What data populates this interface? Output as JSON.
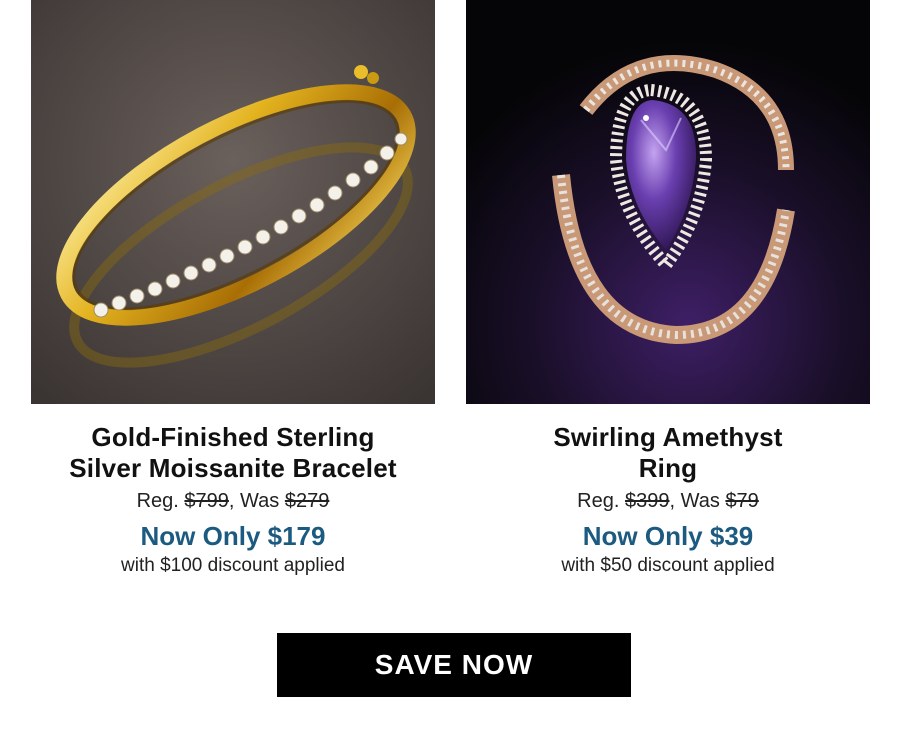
{
  "products": [
    {
      "title_line1": "Gold-Finished Sterling",
      "title_line2": "Silver Moissanite Bracelet",
      "reg_label": "Reg.",
      "reg_price": "$799",
      "was_label": "Was",
      "was_price": "$279",
      "now_text": "Now Only $179",
      "discount_text": "with $100 discount applied"
    },
    {
      "title_line1": "Swirling Amethyst",
      "title_line2": "Ring",
      "reg_label": "Reg.",
      "reg_price": "$399",
      "was_label": "Was",
      "was_price": "$79",
      "now_text": "Now Only $39",
      "discount_text": "with $50 discount applied"
    }
  ],
  "cta": {
    "label": "SAVE NOW"
  },
  "colors": {
    "now_price": "#1c5a80",
    "cta_bg": "#000000",
    "cta_text": "#ffffff"
  }
}
